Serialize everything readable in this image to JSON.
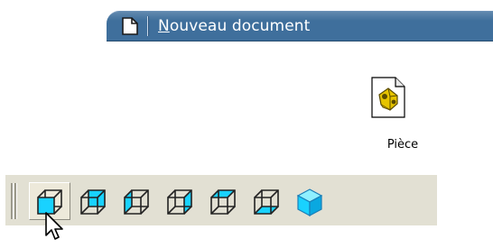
{
  "menu": {
    "new_document": {
      "mnemonic": "N",
      "rest": "ouveau document",
      "icon": "document-icon",
      "background": "#3f6f9c"
    }
  },
  "template": {
    "label": "Pièce",
    "icon": "part-template-icon"
  },
  "view_toolbar": {
    "background": "#e2e0d3",
    "accent": "#19d2ff",
    "buttons": [
      {
        "icon": "view-front-icon",
        "state": "pressed"
      },
      {
        "icon": "view-back-icon",
        "state": "normal"
      },
      {
        "icon": "view-left-icon",
        "state": "normal"
      },
      {
        "icon": "view-right-icon",
        "state": "normal"
      },
      {
        "icon": "view-top-icon",
        "state": "normal"
      },
      {
        "icon": "view-bottom-icon",
        "state": "normal"
      },
      {
        "icon": "view-isometric-icon",
        "state": "normal"
      }
    ]
  },
  "cursor": {
    "icon": "arrow-cursor-icon"
  }
}
